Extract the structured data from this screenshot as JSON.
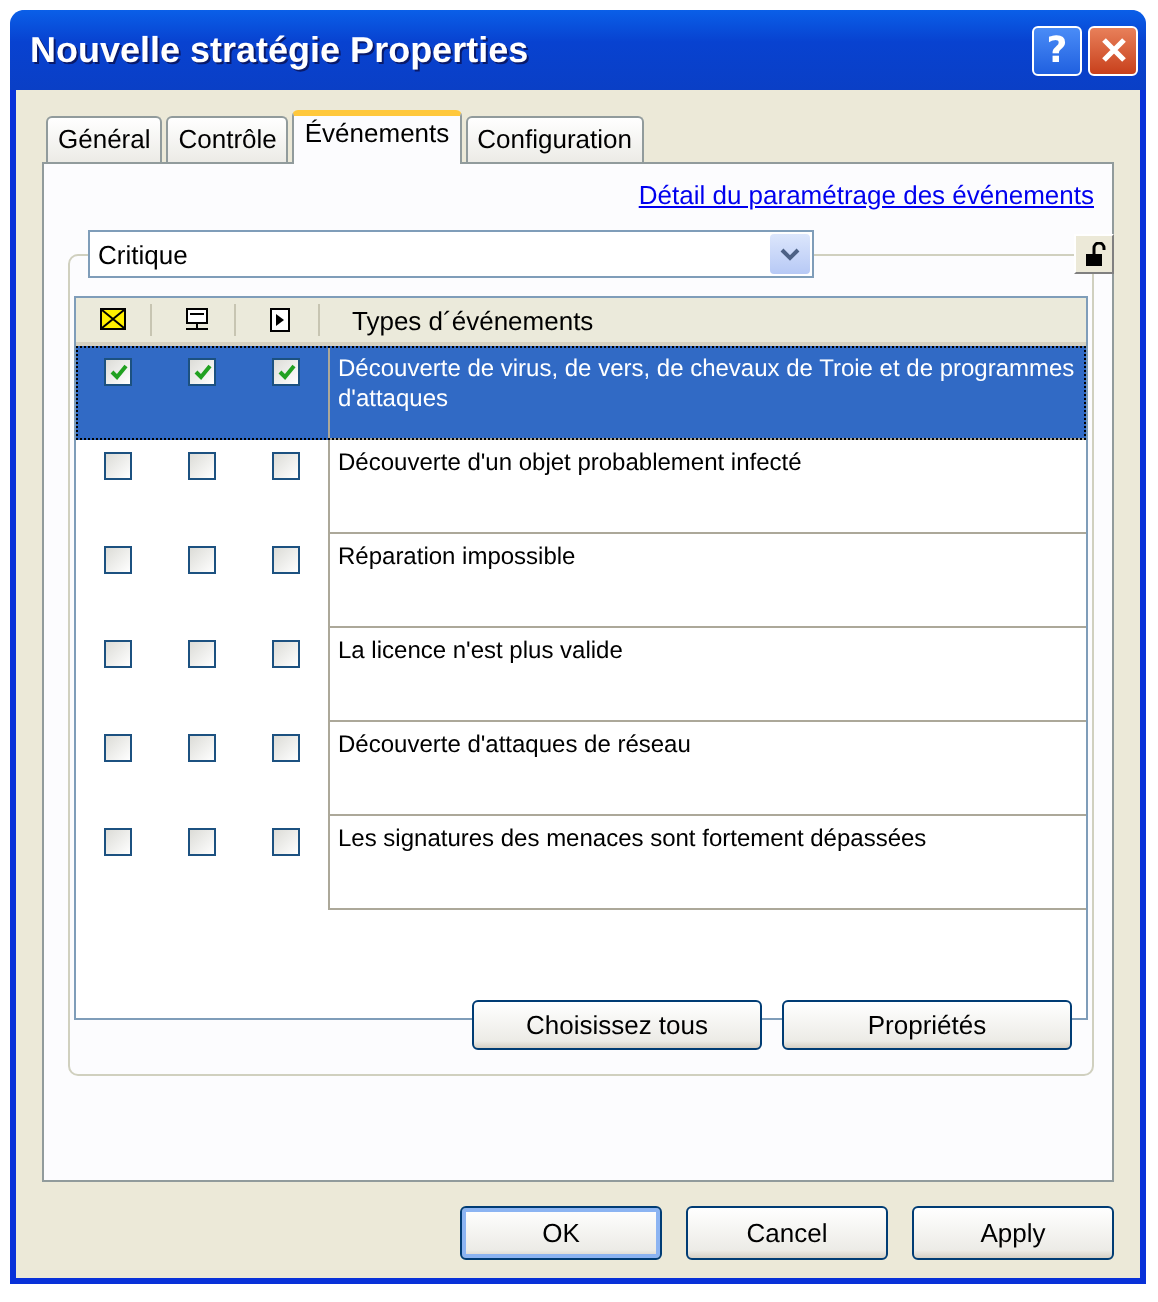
{
  "window": {
    "title": "Nouvelle stratégie Properties",
    "help_button": "?"
  },
  "tabs": [
    {
      "label": "Général",
      "selected": false
    },
    {
      "label": "Contrôle",
      "selected": false
    },
    {
      "label": "Événements",
      "selected": true
    },
    {
      "label": "Configuration",
      "selected": false
    }
  ],
  "link": "Détail du paramétrage des événements",
  "dropdown": {
    "value": "Critique"
  },
  "table": {
    "columns": [
      {
        "kind": "mail"
      },
      {
        "kind": "screen"
      },
      {
        "kind": "log"
      },
      {
        "kind": "text",
        "label": "Types d´événements"
      }
    ],
    "rows": [
      {
        "label": "Découverte de virus, de vers, de chevaux de Troie et de programmes d'attaques",
        "checks": [
          true,
          true,
          true
        ],
        "selected": true
      },
      {
        "label": "Découverte d'un objet probablement infecté",
        "checks": [
          false,
          false,
          false
        ],
        "selected": false
      },
      {
        "label": "Réparation impossible",
        "checks": [
          false,
          false,
          false
        ],
        "selected": false
      },
      {
        "label": "La licence n'est plus valide",
        "checks": [
          false,
          false,
          false
        ],
        "selected": false
      },
      {
        "label": "Découverte d'attaques de réseau",
        "checks": [
          false,
          false,
          false
        ],
        "selected": false
      },
      {
        "label": "Les signatures des menaces sont fortement dépassées",
        "checks": [
          false,
          false,
          false
        ],
        "selected": false
      }
    ]
  },
  "panel_buttons": [
    "Choisissez tous",
    "Propriétés"
  ],
  "dialog_buttons": [
    {
      "label": "OK",
      "default": true
    },
    {
      "label": "Cancel",
      "default": false
    },
    {
      "label": "Apply",
      "default": false
    }
  ]
}
